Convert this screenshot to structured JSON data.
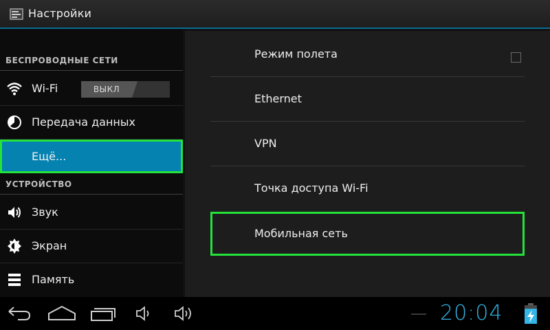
{
  "actionbar": {
    "title": "Настройки",
    "icon": "settings-app-icon"
  },
  "sidebar": {
    "sections": [
      {
        "header": "БЕСПРОВОДНЫЕ СЕТИ",
        "items": [
          {
            "label": "Wi-Fi",
            "icon": "wifi-icon",
            "toggle": "ВЫКЛ"
          },
          {
            "label": "Передача данных",
            "icon": "data-usage-icon"
          },
          {
            "label": "Ещё...",
            "icon": "",
            "selected": true
          }
        ]
      },
      {
        "header": "УСТРОЙСТВО",
        "items": [
          {
            "label": "Звук",
            "icon": "speaker-icon"
          },
          {
            "label": "Экран",
            "icon": "brightness-icon"
          },
          {
            "label": "Память",
            "icon": "storage-icon"
          }
        ]
      }
    ]
  },
  "main": {
    "items": [
      {
        "label": "Режим полета",
        "checkbox": false
      },
      {
        "label": "Ethernet"
      },
      {
        "label": "VPN"
      },
      {
        "label": "Точка доступа Wi-Fi"
      },
      {
        "label": "Мобильная сеть",
        "highlighted": true
      }
    ]
  },
  "navbar": {
    "buttons": [
      "back-icon",
      "home-icon",
      "recent-apps-icon",
      "volume-down-icon",
      "volume-up-icon"
    ],
    "clock": "20:04",
    "battery": "battery-charging-icon"
  },
  "colors": {
    "accent": "#33b5e5",
    "selected": "#0582b0",
    "highlight": "#24e33a"
  }
}
